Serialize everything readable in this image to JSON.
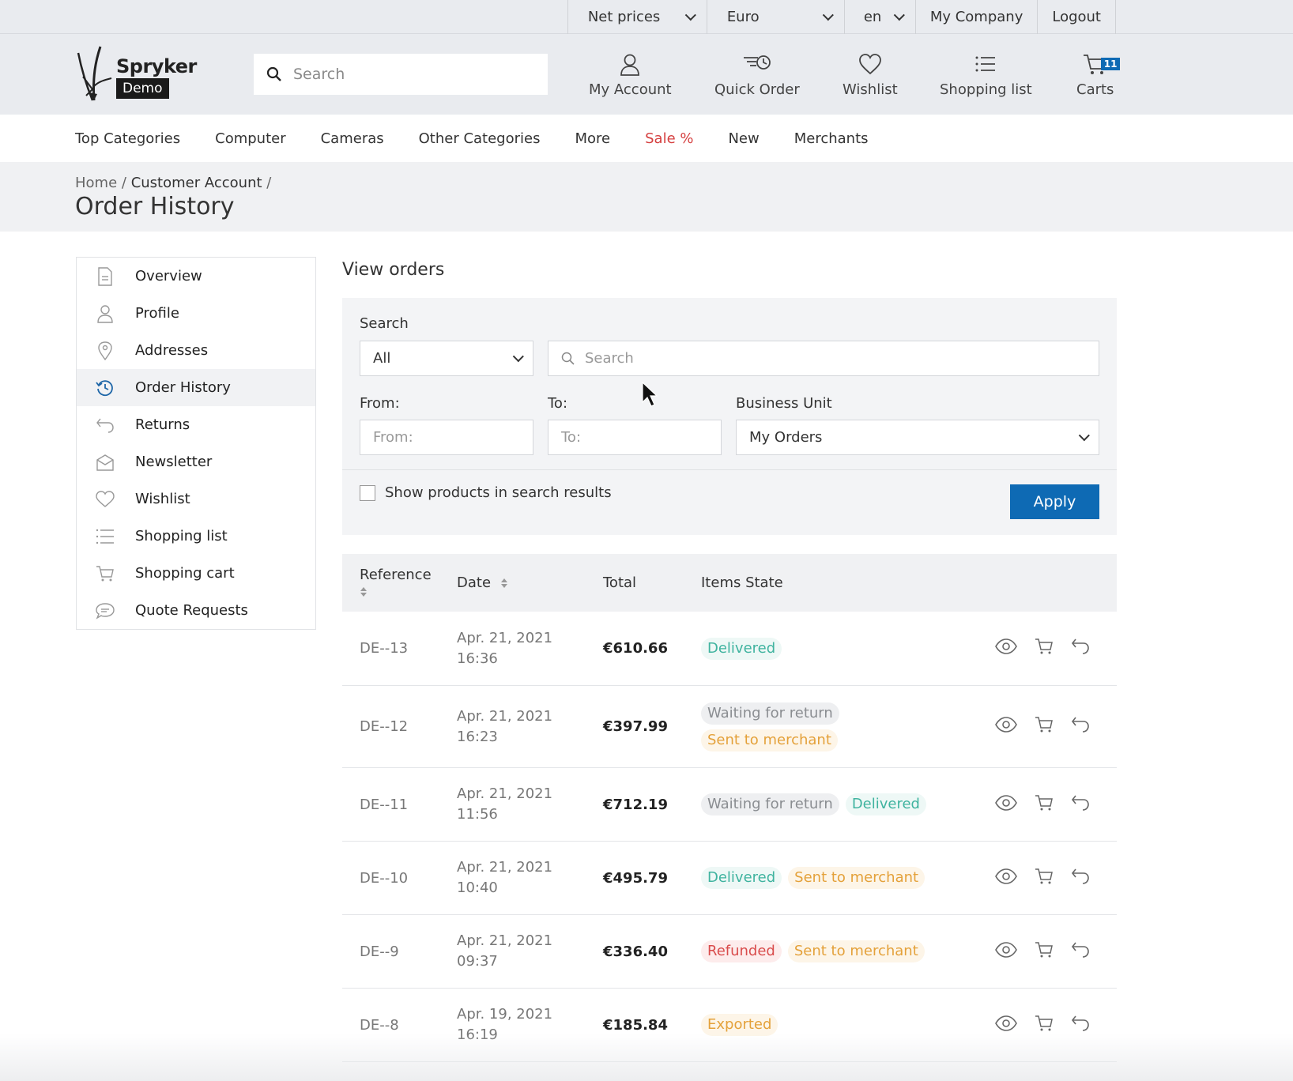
{
  "topbar": {
    "price_mode": "Net prices",
    "currency": "Euro",
    "language": "en",
    "company": "My Company",
    "logout": "Logout"
  },
  "header": {
    "logo_name": "Spryker",
    "logo_badge": "Demo",
    "search_placeholder": "Search",
    "nav": {
      "account": "My Account",
      "quick_order": "Quick Order",
      "wishlist": "Wishlist",
      "shopping_list": "Shopping list",
      "carts": "Carts",
      "cart_count": "11"
    }
  },
  "categories": [
    "Top Categories",
    "Computer",
    "Cameras",
    "Other Categories",
    "More",
    "Sale %",
    "New",
    "Merchants"
  ],
  "breadcrumb": {
    "home": "Home",
    "sep1": "/",
    "account": "Customer Account",
    "sep2": "/",
    "title": "Order History"
  },
  "sidebar": {
    "items": [
      {
        "label": "Overview",
        "icon": "document-icon"
      },
      {
        "label": "Profile",
        "icon": "user-icon"
      },
      {
        "label": "Addresses",
        "icon": "map-pin-icon"
      },
      {
        "label": "Order History",
        "icon": "history-icon"
      },
      {
        "label": "Returns",
        "icon": "return-icon"
      },
      {
        "label": "Newsletter",
        "icon": "envelope-icon"
      },
      {
        "label": "Wishlist",
        "icon": "heart-icon"
      },
      {
        "label": "Shopping list",
        "icon": "list-icon"
      },
      {
        "label": "Shopping cart",
        "icon": "cart-icon"
      },
      {
        "label": "Quote Requests",
        "icon": "chat-icon"
      }
    ]
  },
  "main": {
    "title": "View orders",
    "filter": {
      "search_label": "Search",
      "search_type": "All",
      "search_placeholder": "Search",
      "from_label": "From:",
      "from_placeholder": "From:",
      "to_label": "To:",
      "to_placeholder": "To:",
      "business_unit_label": "Business Unit",
      "business_unit_value": "My Orders",
      "show_products_label": "Show products in search results",
      "apply_label": "Apply"
    },
    "table": {
      "headers": {
        "reference": "Reference",
        "date": "Date",
        "total": "Total",
        "state": "Items State"
      },
      "rows": [
        {
          "ref": "DE--13",
          "date": "Apr. 21, 2021",
          "time": "16:36",
          "total": "€610.66",
          "states": [
            {
              "label": "Delivered",
              "type": "delivered"
            }
          ]
        },
        {
          "ref": "DE--12",
          "date": "Apr. 21, 2021",
          "time": "16:23",
          "total": "€397.99",
          "states": [
            {
              "label": "Waiting for return",
              "type": "waiting"
            },
            {
              "label": "Sent to merchant",
              "type": "merchant"
            }
          ]
        },
        {
          "ref": "DE--11",
          "date": "Apr. 21, 2021",
          "time": "11:56",
          "total": "€712.19",
          "states": [
            {
              "label": "Waiting for return",
              "type": "waiting"
            },
            {
              "label": "Delivered",
              "type": "delivered"
            }
          ]
        },
        {
          "ref": "DE--10",
          "date": "Apr. 21, 2021",
          "time": "10:40",
          "total": "€495.79",
          "states": [
            {
              "label": "Delivered",
              "type": "delivered"
            },
            {
              "label": "Sent to merchant",
              "type": "merchant"
            }
          ]
        },
        {
          "ref": "DE--9",
          "date": "Apr. 21, 2021",
          "time": "09:37",
          "total": "€336.40",
          "states": [
            {
              "label": "Refunded",
              "type": "refunded"
            },
            {
              "label": "Sent to merchant",
              "type": "merchant"
            }
          ]
        },
        {
          "ref": "DE--8",
          "date": "Apr. 19, 2021",
          "time": "16:19",
          "total": "€185.84",
          "states": [
            {
              "label": "Exported",
              "type": "exported"
            }
          ]
        }
      ]
    }
  },
  "colors": {
    "accent": "#0e6ab4",
    "sale": "#d54040",
    "delivered": "#3fb39f",
    "merchant": "#e4a13a",
    "refunded": "#d94c4c"
  }
}
